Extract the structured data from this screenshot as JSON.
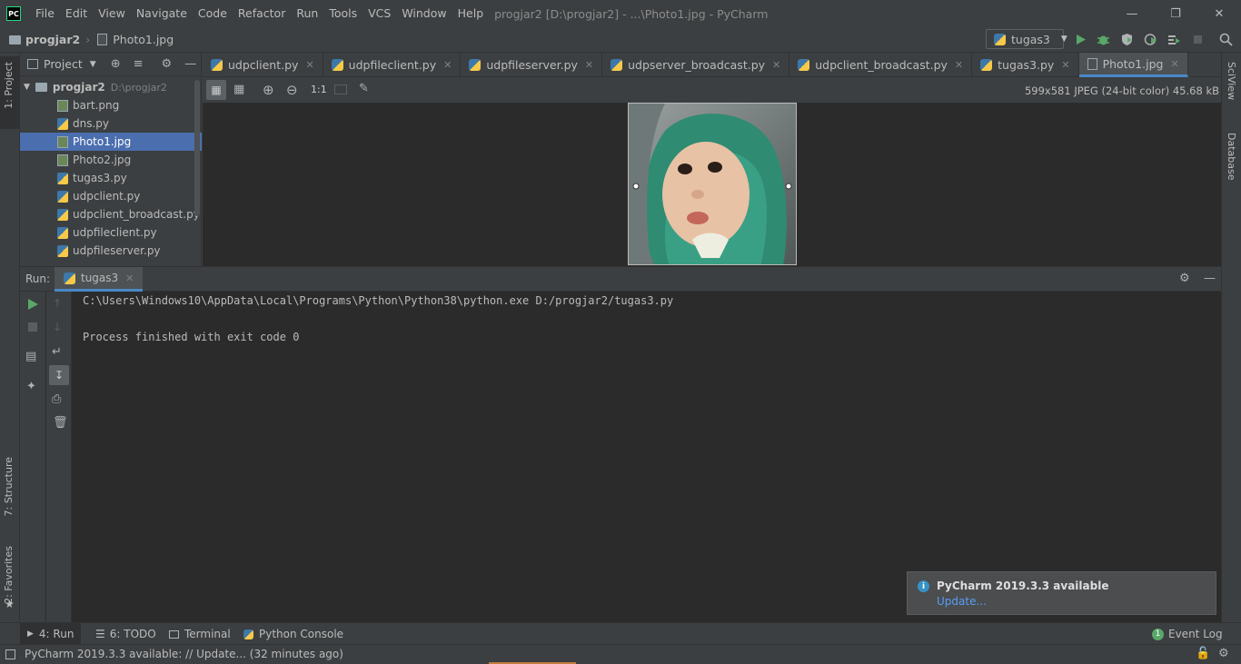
{
  "app": {
    "logo_text": "PC",
    "menu": [
      "File",
      "Edit",
      "View",
      "Navigate",
      "Code",
      "Refactor",
      "Run",
      "Tools",
      "VCS",
      "Window",
      "Help"
    ],
    "window_title": "progjar2 [D:\\progjar2] - ...\\Photo1.jpg - PyCharm"
  },
  "navbar": {
    "project": "progjar2",
    "file": "Photo1.jpg",
    "run_config": "tugas3"
  },
  "project_panel": {
    "title": "Project",
    "root_name": "progjar2",
    "root_path": "D:\\progjar2",
    "files": [
      {
        "name": "bart.png",
        "type": "img"
      },
      {
        "name": "dns.py",
        "type": "py"
      },
      {
        "name": "Photo1.jpg",
        "type": "img",
        "selected": true
      },
      {
        "name": "Photo2.jpg",
        "type": "img"
      },
      {
        "name": "tugas3.py",
        "type": "py"
      },
      {
        "name": "udpclient.py",
        "type": "py"
      },
      {
        "name": "udpclient_broadcast.py",
        "type": "py"
      },
      {
        "name": "udpfileclient.py",
        "type": "py"
      },
      {
        "name": "udpfileserver.py",
        "type": "py"
      }
    ]
  },
  "tabs": [
    "udpclient.py",
    "udpfileclient.py",
    "udpfileserver.py",
    "udpserver_broadcast.py",
    "udpclient_broadcast.py",
    "tugas3.py",
    "Photo1.jpg"
  ],
  "image_viewer": {
    "zoom_label": "1:1",
    "info": "599x581 JPEG (24-bit color) 45.68 kB"
  },
  "run": {
    "label": "Run:",
    "tab": "tugas3",
    "line1": "C:\\Users\\Windows10\\AppData\\Local\\Programs\\Python\\Python38\\python.exe D:/progjar2/tugas3.py",
    "line2": "Process finished with exit code 0"
  },
  "notification": {
    "title": "PyCharm 2019.3.3 available",
    "link": "Update..."
  },
  "stripes": {
    "left_project": "1: Project",
    "left_structure": "7: Structure",
    "left_favorites": "2: Favorites",
    "right_sciview": "SciView",
    "right_database": "Database"
  },
  "bottom_tabs": {
    "run": "4: Run",
    "todo": "6: TODO",
    "terminal": "Terminal",
    "python_console": "Python Console",
    "event_log": "Event Log",
    "event_count": "1"
  },
  "status": {
    "message": "PyCharm 2019.3.3 available: // Update... (32 minutes ago)"
  },
  "colors": {
    "accent": "#4a88c7",
    "selection": "#4b6eaf",
    "run_green": "#59a869",
    "link": "#589df6"
  }
}
